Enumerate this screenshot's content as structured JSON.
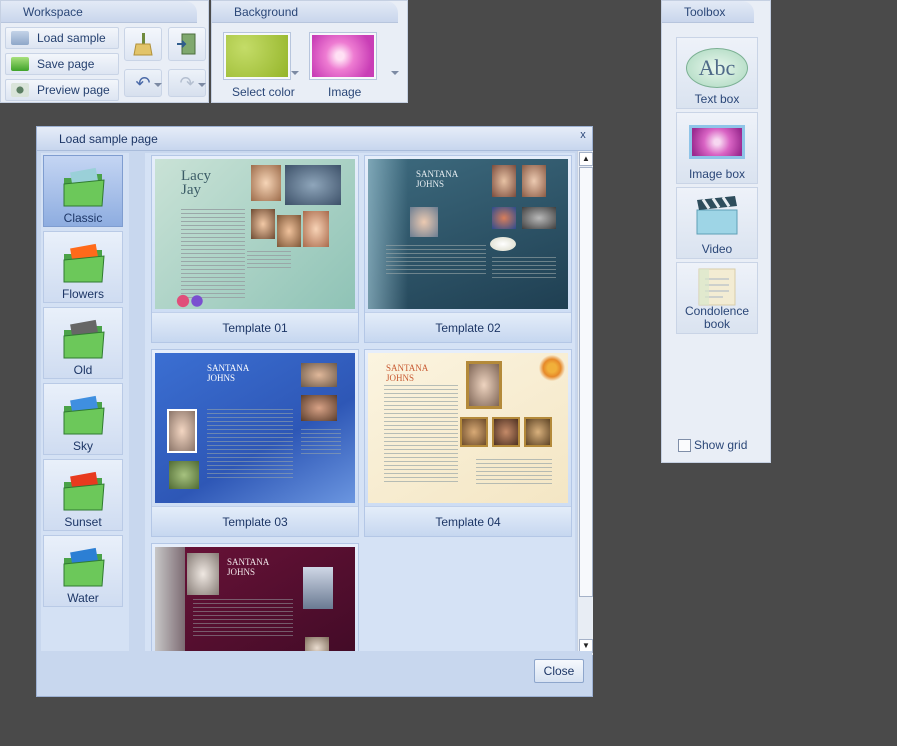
{
  "workspace": {
    "tab": "Workspace",
    "load_sample": "Load sample",
    "save_page": "Save page",
    "preview_page": "Preview page"
  },
  "background": {
    "tab": "Background",
    "select_color": "Select color",
    "image": "Image",
    "color_hex": "#a8c63c"
  },
  "toolbox": {
    "tab": "Toolbox",
    "items": [
      {
        "label": "Text box",
        "icon": "text-box-icon",
        "icon_text": "Abc"
      },
      {
        "label": "Image box",
        "icon": "image-box-icon"
      },
      {
        "label": "Video",
        "icon": "video-icon"
      },
      {
        "label": "Condolence book",
        "icon": "condolence-book-icon"
      }
    ],
    "show_grid": "Show grid"
  },
  "dialog": {
    "title": "Load sample page",
    "close_x": "x",
    "close_button": "Close",
    "categories": [
      {
        "label": "Classic",
        "selected": true,
        "color": "#9ad0d8"
      },
      {
        "label": "Flowers",
        "selected": false,
        "color": "#ff6a1a"
      },
      {
        "label": "Old",
        "selected": false,
        "color": "#666666"
      },
      {
        "label": "Sky",
        "selected": false,
        "color": "#3f8fe0"
      },
      {
        "label": "Sunset",
        "selected": false,
        "color": "#e83a1e"
      },
      {
        "label": "Water",
        "selected": false,
        "color": "#2c7fd4"
      }
    ],
    "templates": [
      {
        "label": "Template 01",
        "name_text": "Lacy Jay"
      },
      {
        "label": "Template 02",
        "name_text": "SANTANA JOHNS"
      },
      {
        "label": "Template 03",
        "name_text": "SANTANA JOHNS"
      },
      {
        "label": "Template 04",
        "name_text": "SANTANA JOHNS"
      },
      {
        "label": "",
        "name_text": "SANTANA JOHNS"
      }
    ]
  }
}
